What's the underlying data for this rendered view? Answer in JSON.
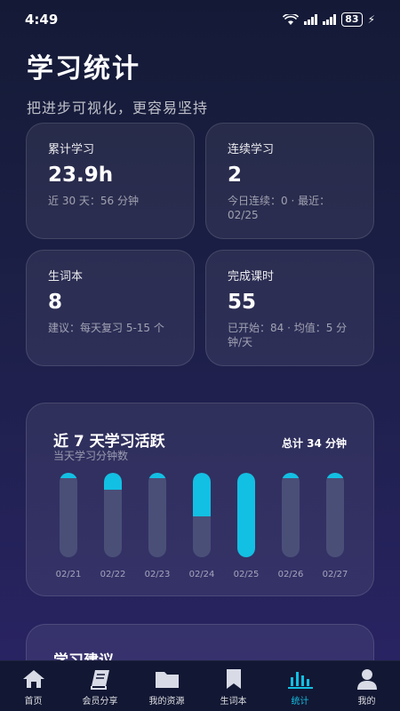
{
  "status_bar": {
    "time": "4:49",
    "battery": "83"
  },
  "header": {
    "title": "学习统计",
    "subtitle": "把进步可视化，更容易坚持"
  },
  "stats": [
    {
      "label": "累计学习",
      "value": "23.9h",
      "note": "近 30 天：56 分钟"
    },
    {
      "label": "连续学习",
      "value": "2",
      "note": "今日连续：0 · 最近：02/25"
    },
    {
      "label": "生词本",
      "value": "8",
      "note": "建议：每天复习 5-15 个"
    },
    {
      "label": "完成课时",
      "value": "55",
      "note": "已开始：84 · 均值：5 分钟/天"
    }
  ],
  "activity": {
    "title": "近 7 天学习活跃",
    "subtitle": "当天学习分钟数",
    "total": "总计 34 分钟"
  },
  "chart_data": {
    "type": "bar",
    "categories": [
      "02/21",
      "02/22",
      "02/23",
      "02/24",
      "02/25",
      "02/26",
      "02/27"
    ],
    "values": [
      0.05,
      0.2,
      0.05,
      0.52,
      1.0,
      0.05,
      0.05
    ],
    "ylim": [
      0,
      1
    ],
    "fill_color": "#12c0e3",
    "track_color": "#4a4f78"
  },
  "advice": {
    "title": "学习建议"
  },
  "tabs": [
    {
      "label": "首页",
      "icon": "home-icon"
    },
    {
      "label": "会员分享",
      "icon": "book-icon"
    },
    {
      "label": "我的资源",
      "icon": "folder-icon"
    },
    {
      "label": "生词本",
      "icon": "bookmark-icon"
    },
    {
      "label": "统计",
      "icon": "stats-icon",
      "active": true
    },
    {
      "label": "我的",
      "icon": "user-icon"
    }
  ]
}
